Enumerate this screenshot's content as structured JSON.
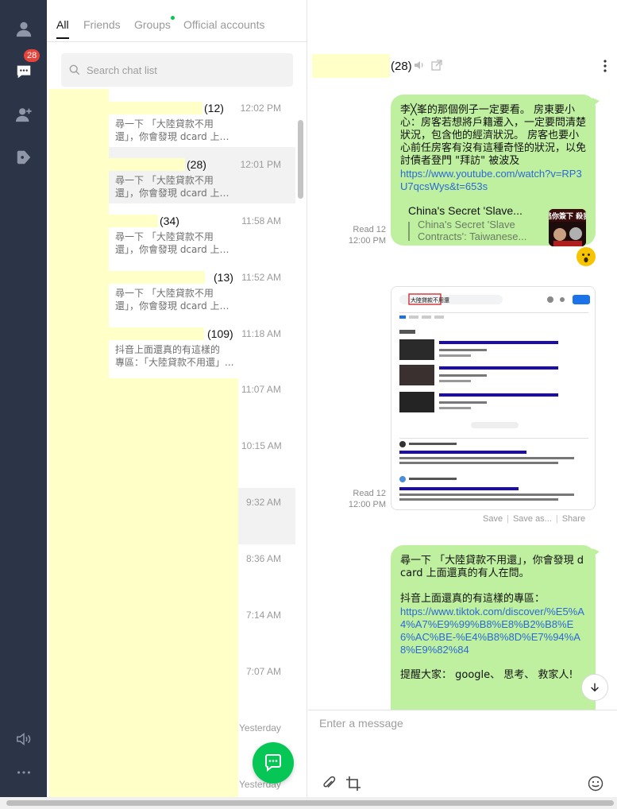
{
  "rail": {
    "unread_badge": "28",
    "items": [
      "profile-icon",
      "chat-icon",
      "add-friend-icon",
      "openchat-icon",
      "sound-icon",
      "more-icon"
    ]
  },
  "tabs": [
    {
      "label": "All"
    },
    {
      "label": "Friends"
    },
    {
      "label": "Groups"
    },
    {
      "label": "Official accounts"
    }
  ],
  "search": {
    "placeholder": "Search chat list"
  },
  "chats": [
    {
      "count": "(12)",
      "time": "12:02 PM",
      "preview1": "尋一下 「大陸貸款不用",
      "preview2": "還」，你會發現 dcard 上面還..."
    },
    {
      "count": "(28)",
      "time": "12:01 PM",
      "preview1": "尋一下 「大陸貸款不用",
      "preview2": "還」，你會發現 dcard 上面還..."
    },
    {
      "count": "(34)",
      "time": "11:58 AM",
      "preview1": "尋一下 「大陸貸款不用",
      "preview2": "還」，你會發現 dcard 上面還..."
    },
    {
      "count": "(13)",
      "time": "11:52 AM",
      "preview1": "尋一下 「大陸貸款不用",
      "preview2": "還」，你會發現 dcard 上面還..."
    },
    {
      "count": "(109)",
      "time": "11:18 AM",
      "preview1": "抖音上面還真的有這樣的",
      "preview2": "專區：「大陸貸款不用還」..."
    }
  ],
  "other_times": [
    "11:07 AM",
    "10:15 AM",
    "9:32 AM",
    "8:36 AM",
    "7:14 AM",
    "7:07 AM",
    "Yesterday",
    "Yesterday"
  ],
  "conversation": {
    "member_count": "(28)",
    "messages": [
      {
        "text": "李╳峯的那個例子一定要看。 房東要小心：房客若想將戶籍遷入，一定要問清楚狀況，包含他的經濟狀況。 房客也要小心前任房客有沒有這種奇怪的狀況，以免討債者登門 \"拜訪\" 被波及",
        "link": "https://www.youtube.com/watch?v=RP3U7qcsWys&t=653s",
        "preview_title": "China's Secret 'Slave...",
        "preview_desc1": "China's Secret 'Slave",
        "preview_desc2": "Contracts': Taiwanese...",
        "thumb_text": "逃你簽下 殺我",
        "read": "Read 12",
        "time": "12:00 PM"
      },
      {
        "type": "image",
        "read": "Read 12",
        "time": "12:00 PM",
        "actions": [
          "Save",
          "Save as...",
          "Share"
        ],
        "search_query": "大陸貸款不用還"
      },
      {
        "text1": "尋一下 「大陸貸款不用還」，你會發現 dcard 上面還真的有人在問。",
        "text2": "抖音上面還真的有這樣的專區：",
        "link": "https://www.tiktok.com/discover/%E5%A4%A7%E9%99%B8%E8%B2%B8%E6%AC%BE-%E4%B8%8D%E7%94%A8%E9%82%84",
        "text3": "提醒大家： google、 思考、 救家人!"
      }
    ]
  },
  "composer": {
    "placeholder": "Enter a message"
  },
  "colors": {
    "accent": "#06c755",
    "rail": "#2c3447",
    "bubble": "#bff0a0",
    "badge": "#e8433b"
  }
}
